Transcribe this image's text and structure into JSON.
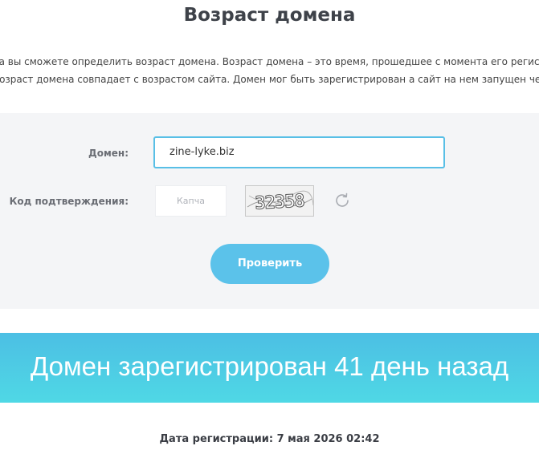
{
  "title": "Возраст домена",
  "description": {
    "line1": "са вы сможете определить возраст домена. Возраст домена – это время, прошедшее с момента его регистрации",
    "line2": " возраст домена совпадает с возрастом сайта. Домен мог быть зарегистрирован а сайт на нем запущен через"
  },
  "form": {
    "domain_label": "Домен:",
    "domain_value": "zine-lyke.biz",
    "code_label": "Код подтверждения:",
    "captcha_placeholder": "Капча",
    "captcha_text": "32358",
    "refresh_icon": "refresh-icon",
    "submit_label": "Проверить"
  },
  "result": {
    "headline": "Домен зарегистрирован 41 день назад",
    "registration_date": "Дата регистрации: 7 мая 2026 02:42"
  },
  "colors": {
    "accent": "#5bc2ea",
    "input_border": "#58bfe6",
    "banner_start": "#4cbfe4",
    "banner_end": "#4fd8e5",
    "panel_bg": "#f4f5f7"
  }
}
